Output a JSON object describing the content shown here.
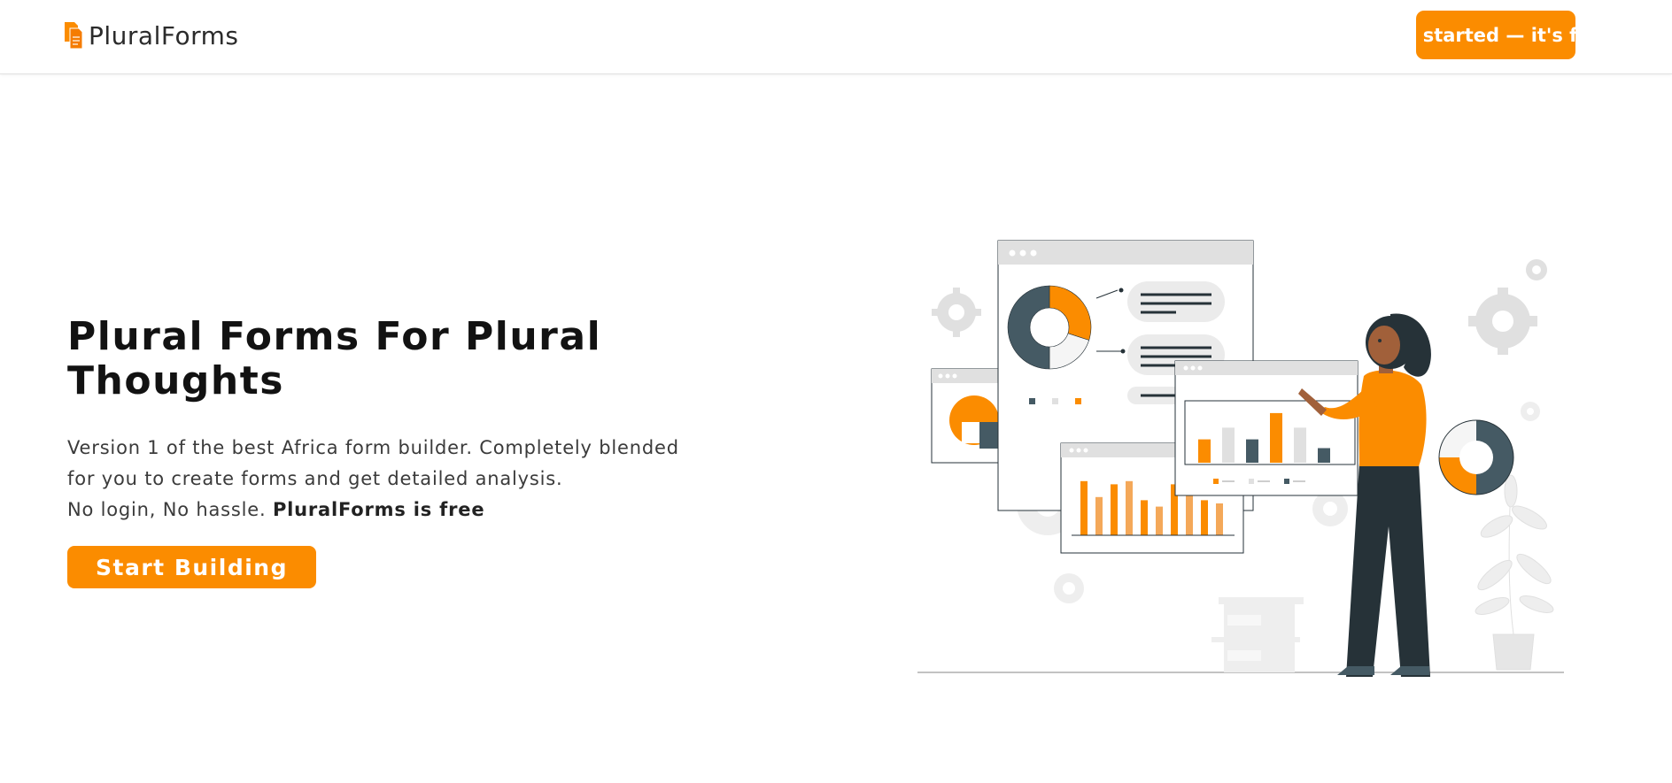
{
  "nav": {
    "brand_icon": "document-stack-icon",
    "brand_name": "PluralForms",
    "cta_label": "Get started — it's free"
  },
  "hero": {
    "title": "Plural Forms For Plural Thoughts",
    "description_line_1": "Version 1 of the best Africa form builder. Completely blended",
    "description_line_2": "for you to create forms and get detailed analysis.",
    "description_line_3_prefix": "No login, No hassle. ",
    "description_line_3_strong": "PluralForms is free",
    "button_label": "Start Building"
  },
  "illustration": {
    "semantic": "woman-presenting-analytics-dashboards-illustration",
    "donut_chart": {
      "type": "pie",
      "values": [
        0.3,
        0.2,
        0.5
      ]
    },
    "bar_chart_small": {
      "type": "bar",
      "values": [
        0.4,
        0.6,
        0.4,
        0.85,
        0.6,
        0.25
      ]
    },
    "bar_chart_large": {
      "type": "bar",
      "values": [
        0.85,
        0.6,
        0.8,
        0.85,
        0.55,
        0.45,
        0.8,
        0.65,
        0.55,
        0.5
      ]
    }
  },
  "colors": {
    "accent": "#fb8c00",
    "dark": "#455a64",
    "light_gray": "#e0e0e0",
    "text": "#121212"
  }
}
